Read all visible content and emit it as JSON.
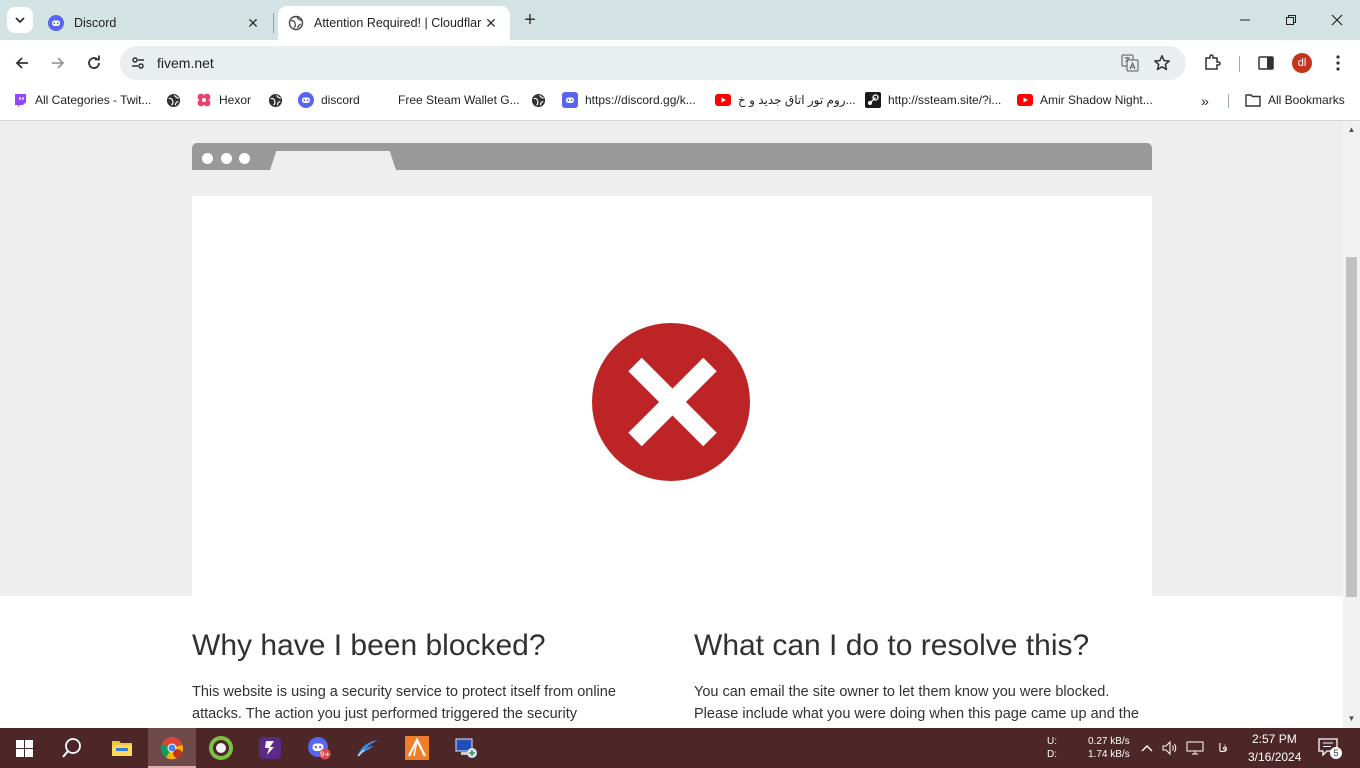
{
  "browser": {
    "tabs": [
      {
        "title": "Discord",
        "favicon": "discord-icon",
        "active": false
      },
      {
        "title": "Attention Required! | Cloudflare",
        "favicon": "globe-icon",
        "active": true
      }
    ],
    "url": "fivem.net",
    "avatar_initials": "dl"
  },
  "bookmarks": {
    "items": [
      {
        "label": "All Categories - Twit...",
        "icon": "twitch-icon"
      },
      {
        "label": "",
        "icon": "globe-icon"
      },
      {
        "label": "Hexor",
        "icon": "hexor-icon"
      },
      {
        "label": "",
        "icon": "globe-icon"
      },
      {
        "label": "discord",
        "icon": "discord-icon"
      },
      {
        "label": "Free Steam Wallet G...",
        "icon": "blank-page-icon"
      },
      {
        "label": "",
        "icon": "globe-icon"
      },
      {
        "label": "https://discord.gg/k...",
        "icon": "discord-icon"
      },
      {
        "label": "روم تور اتاق جدید و خ...",
        "icon": "youtube-icon"
      },
      {
        "label": "http://ssteam.site/?i...",
        "icon": "steam-icon"
      },
      {
        "label": "Amir Shadow Night...",
        "icon": "youtube-icon"
      }
    ],
    "all_bookmarks": "All Bookmarks"
  },
  "page": {
    "left_heading": "Why have I been blocked?",
    "left_text_1": "This website is using a security service to protect itself from online",
    "left_text_2": "attacks. The action you just performed triggered the security",
    "right_heading": "What can I do to resolve this?",
    "right_text_1": "You can email the site owner to let them know you were blocked.",
    "right_text_2": "Please include what you were doing when this page came up and the",
    "error_color": "#bd2426"
  },
  "taskbar": {
    "upload_label": "U:",
    "download_label": "D:",
    "upload_speed": "0.27 kB/s",
    "download_speed": "1.74 kB/s",
    "language": "فا",
    "time": "2:57 PM",
    "date": "3/16/2024",
    "notification_count": "5",
    "discord_badge": "9+"
  }
}
